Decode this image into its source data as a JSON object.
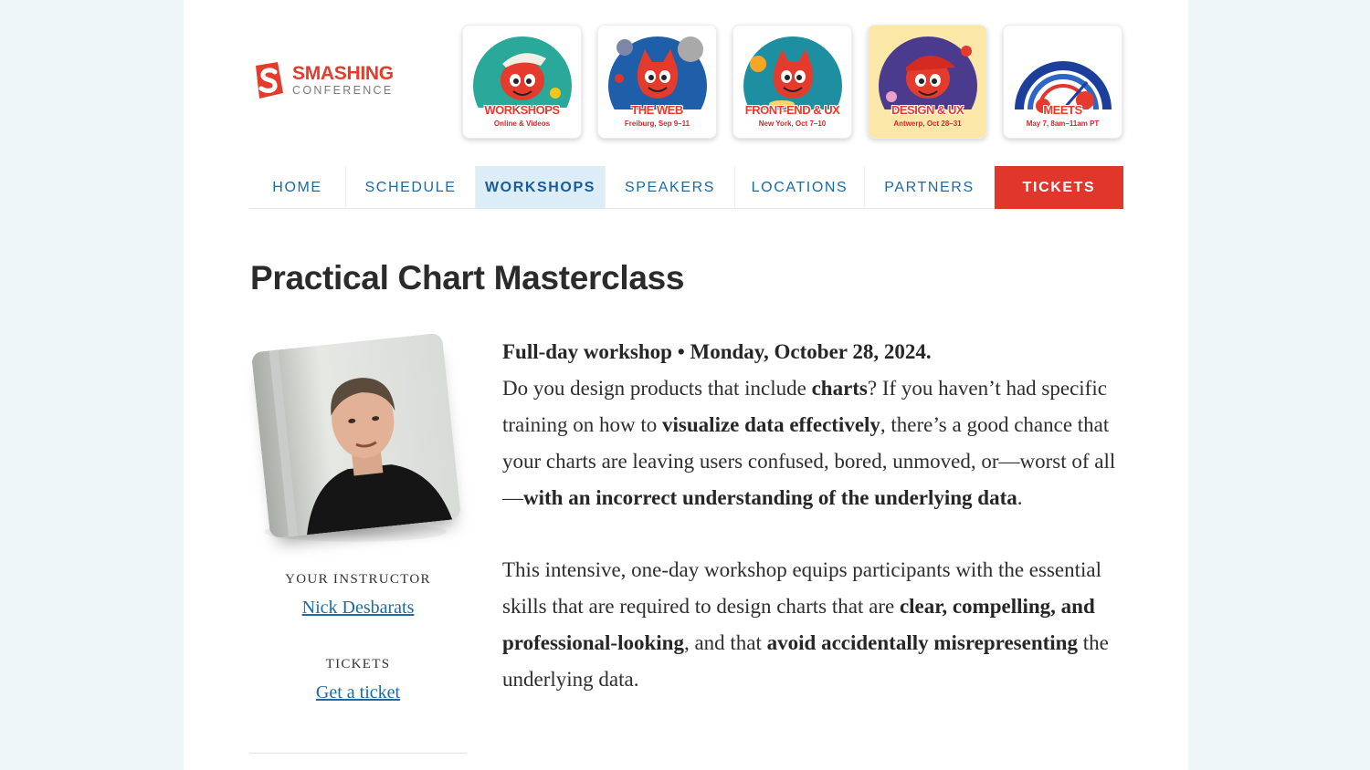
{
  "logo": {
    "title": "SMASHING",
    "subtitle": "CONFERENCE"
  },
  "events": [
    {
      "title": "WORKSHOPS",
      "subtitle": "Online & Videos",
      "art": "workshops-cat-illustration",
      "active": false
    },
    {
      "title": "THE WEB",
      "subtitle": "Freiburg, Sep 9–11",
      "art": "the-web-cat-illustration",
      "active": false
    },
    {
      "title": "FRONT-END & UX",
      "subtitle": "New York, Oct 7–10",
      "art": "front-end-ux-cat-illustration",
      "active": false
    },
    {
      "title": "DESIGN & UX",
      "subtitle": "Antwerp, Oct 28–31",
      "art": "design-ux-cat-illustration",
      "active": true
    },
    {
      "title": "MEETS",
      "subtitle": "May 7, 8am–11am PT",
      "art": "meets-cat-illustration",
      "active": false
    }
  ],
  "nav": {
    "items": [
      {
        "label": "HOME"
      },
      {
        "label": "SCHEDULE"
      },
      {
        "label": "WORKSHOPS",
        "active": true
      },
      {
        "label": "SPEAKERS"
      },
      {
        "label": "LOCATIONS"
      },
      {
        "label": "PARTNERS"
      },
      {
        "label": "TICKETS",
        "cta": true
      }
    ]
  },
  "page": {
    "title": "Practical Chart Masterclass"
  },
  "sidebar": {
    "instructor_label": "YOUR INSTRUCTOR",
    "instructor_name": "Nick Desbarats",
    "tickets_label": "TICKETS",
    "tickets_link": "Get a ticket"
  },
  "content": {
    "intro_bold": "Full-day workshop • Monday, October 28, 2024.",
    "p1": {
      "t1": "Do you design products that include ",
      "b1": "charts",
      "t2": "? If you haven’t had specific training on how to ",
      "b2": "visualize data effectively",
      "t3": ", there’s a good chance that your charts are leaving users confused, bored, unmoved, or—worst of all—",
      "b3": "with an incorrect understanding of the underlying data",
      "t4": "."
    },
    "p2": {
      "t1": "This intensive, one-day workshop equips participants with the essential skills that are required to design charts that are ",
      "b1": "clear, compelling, and professional-looking",
      "t2": ", and that ",
      "b2": "avoid accidentally misrepresenting",
      "t3": " the underlying data."
    }
  },
  "colors": {
    "brand_red": "#e0362c",
    "link_blue": "#1a6aa8",
    "active_tab_bg": "#dcedf8",
    "active_card_bg": "#fbe8a8"
  }
}
